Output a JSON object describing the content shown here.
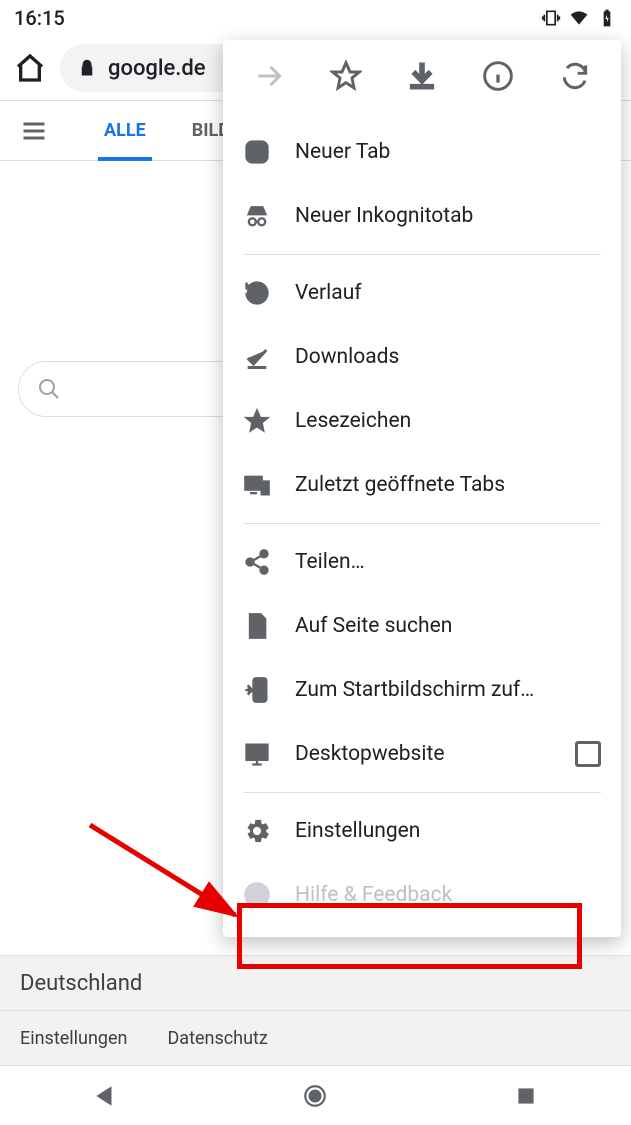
{
  "statusbar": {
    "time": "16:15"
  },
  "toolbar": {
    "url": "google.de"
  },
  "google": {
    "tabs": {
      "all": "ALLE",
      "images": "BILDER"
    },
    "footer_country": "Deutschland",
    "footer_links": {
      "settings": "Einstellungen",
      "privacy": "Datenschutz"
    }
  },
  "menu": {
    "new_tab": "Neuer Tab",
    "incognito": "Neuer Inkognitotab",
    "history": "Verlauf",
    "downloads": "Downloads",
    "bookmarks": "Lesezeichen",
    "recent_tabs": "Zuletzt geöffnete Tabs",
    "share": "Teilen…",
    "find": "Auf Seite suchen",
    "add_home": "Zum Startbildschirm zuf…",
    "desktop_site": "Desktopwebsite",
    "settings": "Einstellungen",
    "help": "Hilfe & Feedback"
  }
}
